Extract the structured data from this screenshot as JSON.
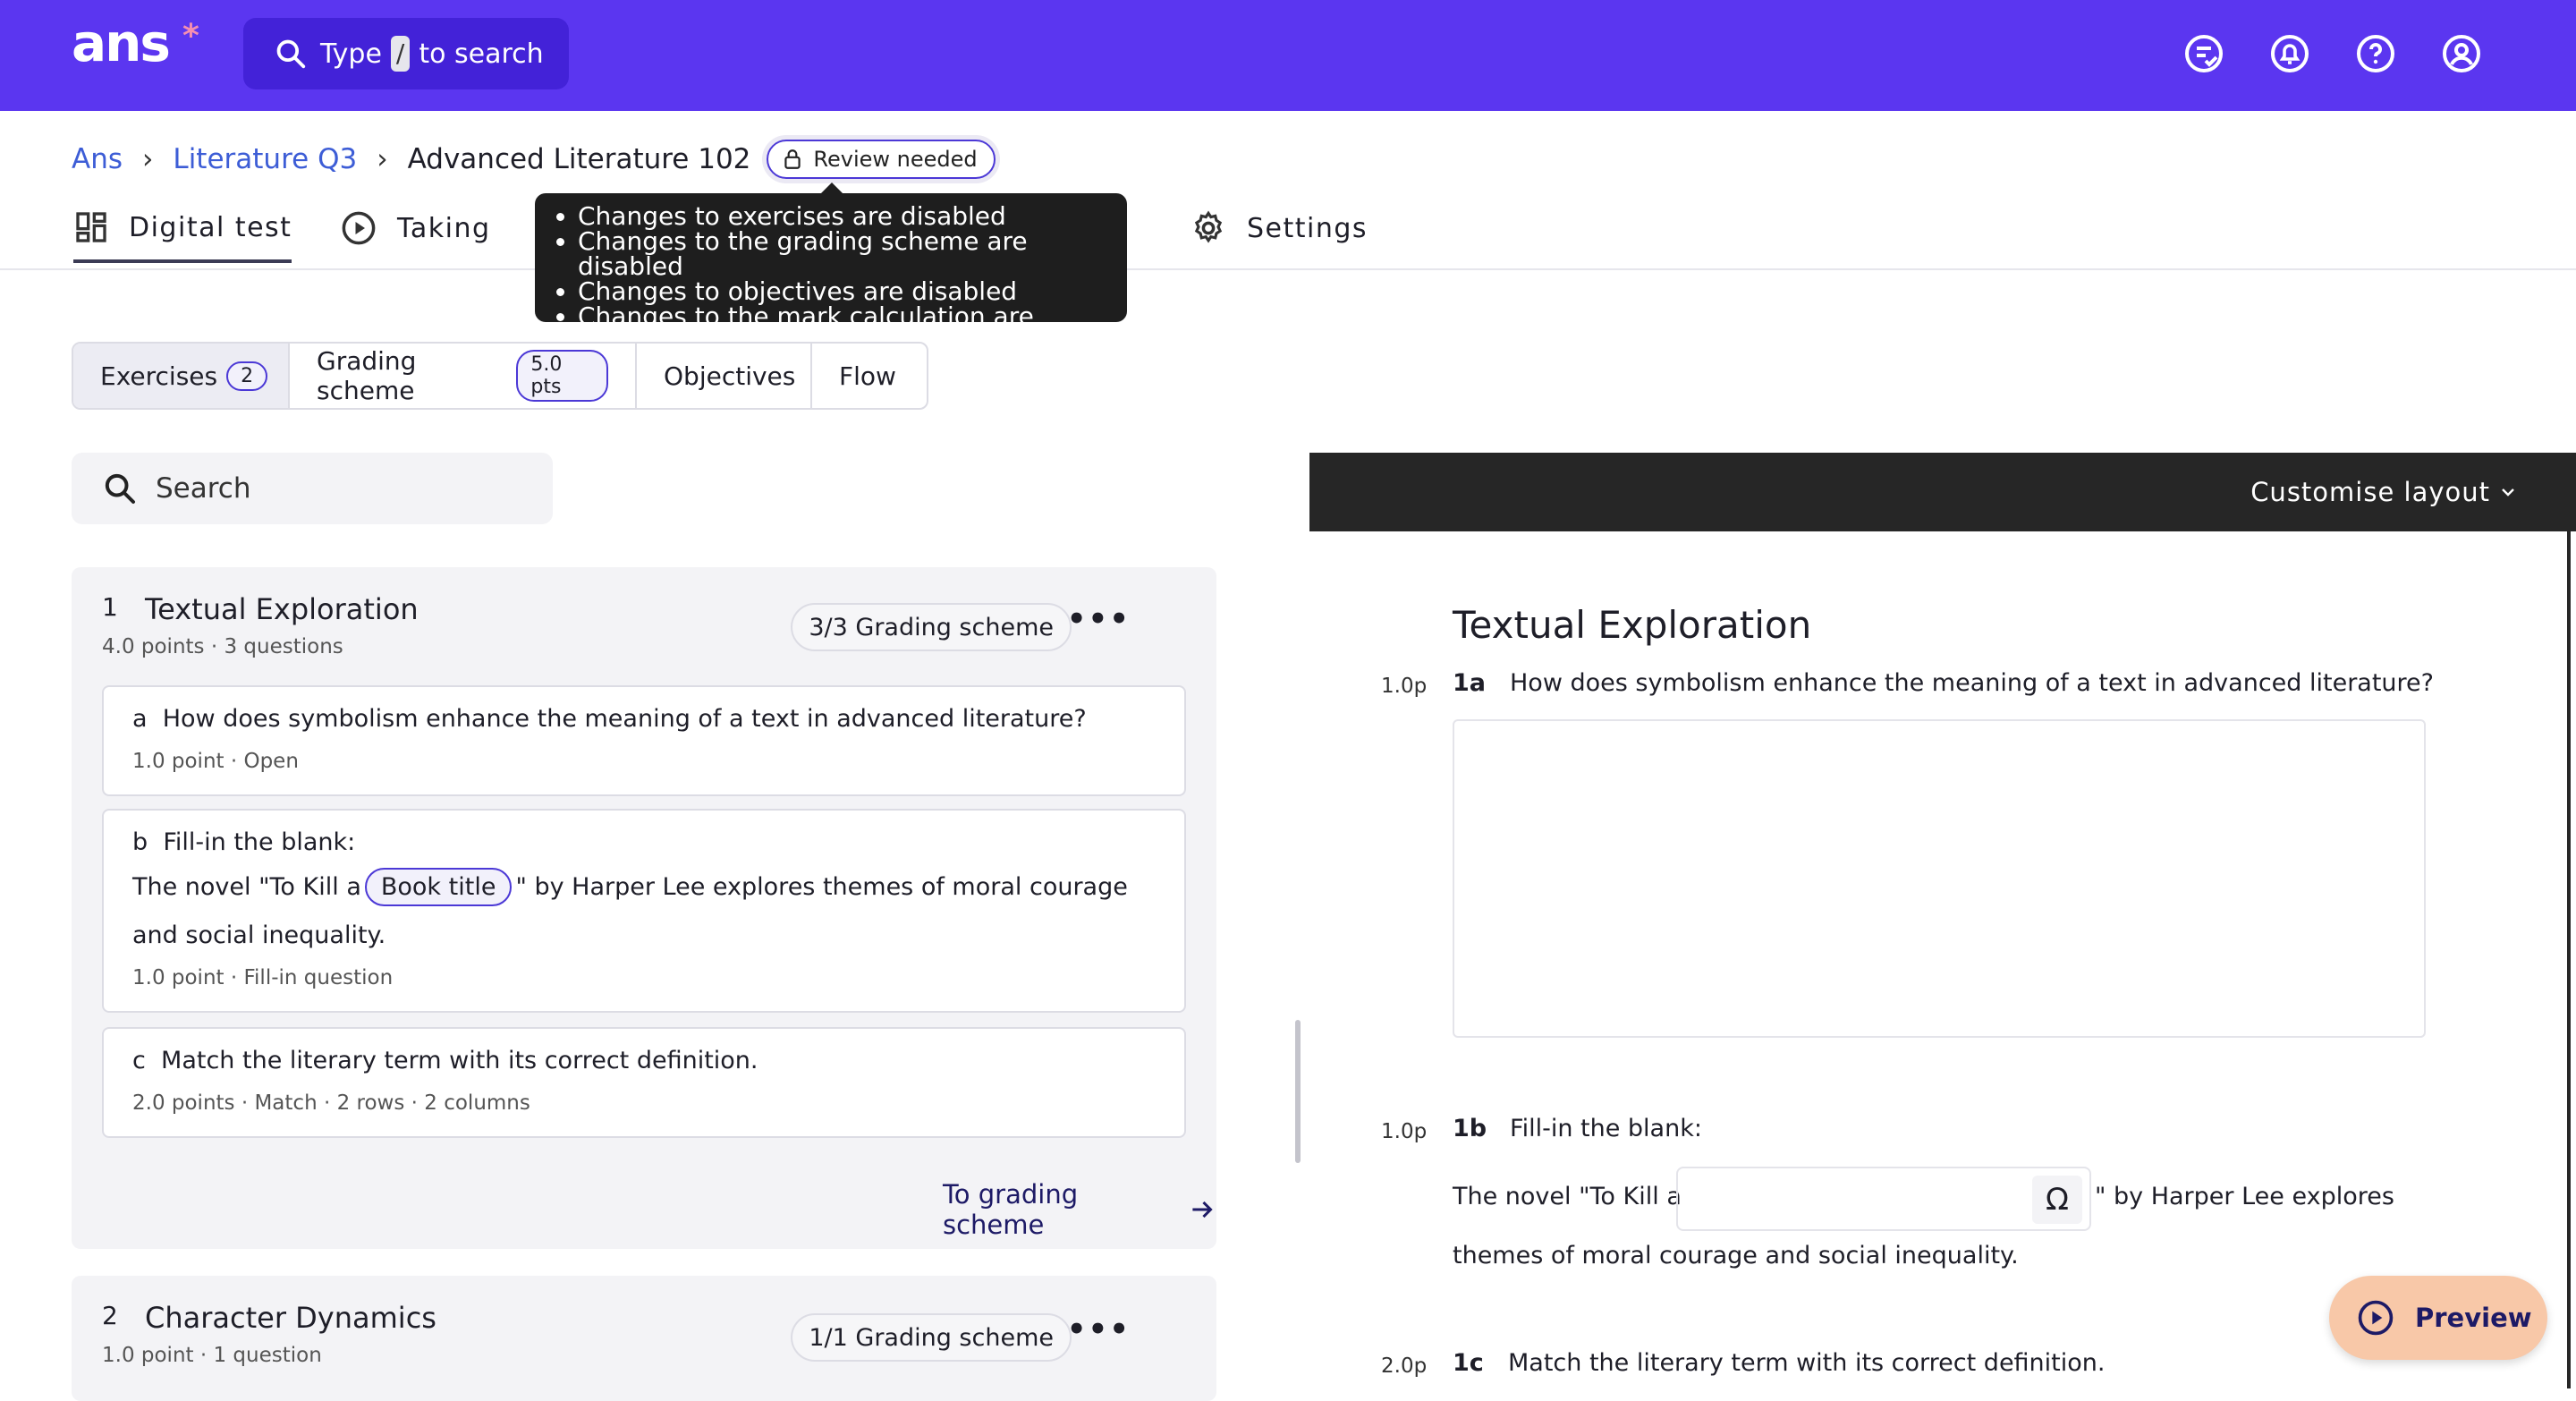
{
  "topbar": {
    "logo": "ans",
    "logo_star": "*",
    "search_prefix": "Type",
    "search_key": "/",
    "search_suffix": "to search",
    "icons": [
      "feedback-icon",
      "notifications-icon",
      "help-icon",
      "account-icon"
    ],
    "bg_color": "#5b36f0"
  },
  "breadcrumb": {
    "items": [
      "Ans",
      "Literature Q3"
    ],
    "current": "Advanced Literature 102",
    "badge": "Review needed"
  },
  "tabs": [
    {
      "label": "Digital test",
      "icon": "grid-icon"
    },
    {
      "label": "Taking",
      "icon": "play-circle-icon"
    },
    {
      "label": "Settings",
      "icon": "gear-icon"
    }
  ],
  "tooltip": {
    "items": [
      "Changes to exercises are disabled",
      "Changes to the grading scheme are disabled",
      "Changes to objectives are disabled",
      "Changes to the mark calculation are disabled"
    ]
  },
  "segments": [
    {
      "label": "Exercises",
      "badge": "2"
    },
    {
      "label": "Grading scheme",
      "badge": "5.0 pts"
    },
    {
      "label": "Objectives"
    },
    {
      "label": "Flow"
    }
  ],
  "search": {
    "placeholder": "Search"
  },
  "exercises": [
    {
      "number": "1",
      "title": "Textual Exploration",
      "meta": "4.0 points · 3 questions",
      "grading": "3/3 Grading scheme",
      "questions": [
        {
          "letter": "a",
          "text": "How does symbolism enhance the meaning of a text in advanced literature?",
          "meta": "1.0 point · Open"
        },
        {
          "letter": "b",
          "text": "Fill-in the blank:",
          "fill_before": "The novel \"To Kill a",
          "fill_blank": "Book title",
          "fill_after": "\" by Harper Lee explores themes of moral courage",
          "fill_line2": "and social inequality.",
          "meta": "1.0 point · Fill-in question"
        },
        {
          "letter": "c",
          "text": "Match the literary term with its correct definition.",
          "meta": "2.0 points · Match · 2 rows · 2 columns"
        }
      ],
      "link": "To grading scheme"
    },
    {
      "number": "2",
      "title": "Character Dynamics",
      "meta": "1.0 point · 1 question",
      "grading": "1/1 Grading scheme"
    }
  ],
  "preview": {
    "header": "Customise layout",
    "title": "Textual Exploration",
    "q1": {
      "pts": "1.0p",
      "num": "1a",
      "text": "How does symbolism enhance the meaning of a text in advanced literature?"
    },
    "q2": {
      "pts": "1.0p",
      "num": "1b",
      "text": "Fill-in the blank:",
      "before": "The novel \"To Kill a",
      "after": "\" by Harper Lee explores",
      "line2": "themes of moral courage and social inequality.",
      "omega": "Ω"
    },
    "q3": {
      "pts": "2.0p",
      "num": "1c",
      "text": "Match the literary term with its correct definition."
    },
    "button": "Preview"
  }
}
